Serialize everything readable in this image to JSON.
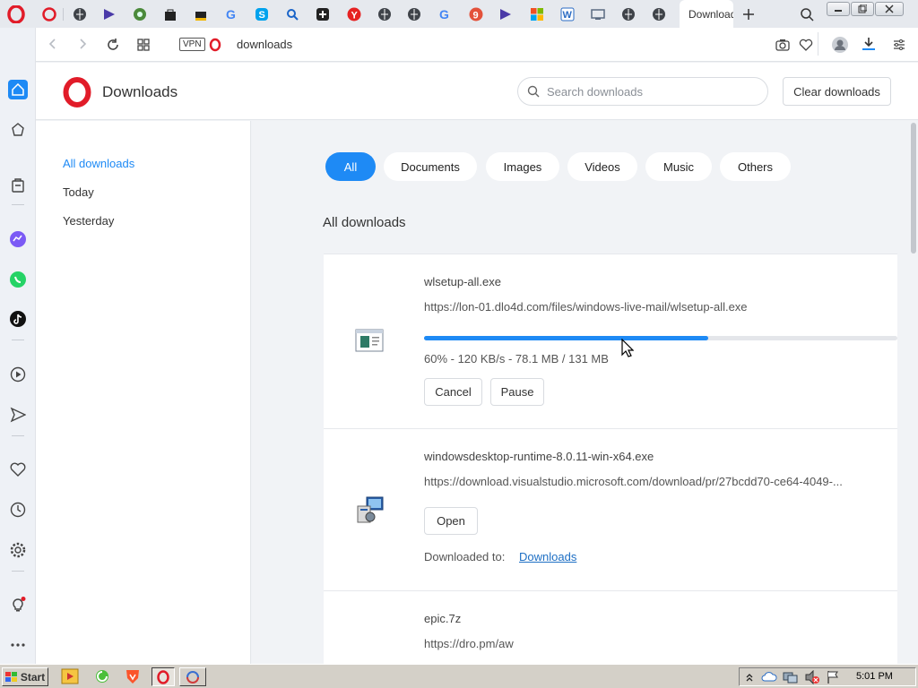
{
  "browser": {
    "active_tab_title": "Downloads",
    "address": "downloads",
    "vpn_badge": "VPN",
    "tab_icons": [
      "opera-icon",
      "globe-icon",
      "play-icon",
      "globe-icon",
      "shopping-bag-icon",
      "shopping-bag-icon",
      "google-icon",
      "skype-icon",
      "search-icon",
      "add-icon",
      "yandex-icon",
      "globe-icon",
      "globe-icon",
      "google-icon",
      "opera-gx-icon",
      "play-icon",
      "microsoft-icon",
      "word-icon",
      "screen-icon",
      "globe-icon",
      "globe-icon"
    ]
  },
  "header": {
    "title": "Downloads",
    "search_placeholder": "Search downloads",
    "clear_label": "Clear downloads"
  },
  "nav": {
    "items": [
      "All downloads",
      "Today",
      "Yesterday"
    ],
    "active": "All downloads"
  },
  "filters": {
    "items": [
      "All",
      "Documents",
      "Images",
      "Videos",
      "Music",
      "Others"
    ],
    "active": "All"
  },
  "section_title": "All downloads",
  "downloads": [
    {
      "name": "wlsetup-all.exe",
      "url": "https://lon-01.dlo4d.com/files/windows-live-mail/wlsetup-all.exe",
      "progress_fraction": 0.6,
      "status": "60% - 120 KB/s - 78.1 MB / 131 MB",
      "cancel_label": "Cancel",
      "pause_label": "Pause"
    },
    {
      "name": "windowsdesktop-runtime-8.0.11-win-x64.exe",
      "url": "https://download.visualstudio.microsoft.com/download/pr/27bcdd70-ce64-4049-...",
      "open_label": "Open",
      "downloaded_to_label": "Downloaded to:",
      "folder_link": "Downloads"
    },
    {
      "name": "epic.7z",
      "url": "https://dro.pm/aw"
    }
  ],
  "taskbar": {
    "start_label": "Start",
    "clock": "5:01 PM"
  },
  "colors": {
    "accent": "#1e8af5",
    "opera_red": "#e11c29"
  }
}
